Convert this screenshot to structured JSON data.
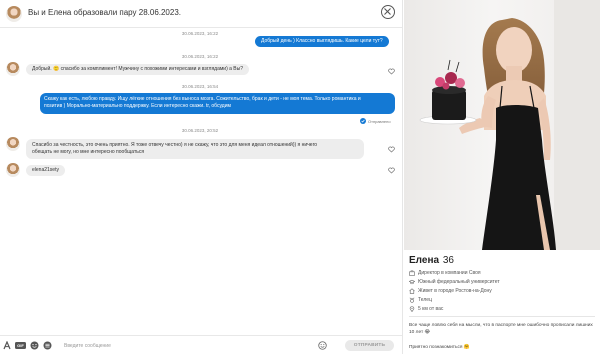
{
  "header": {
    "title": "Вы и Елена образовали пару 28.06.2023.",
    "close_icon": "close-circle-icon"
  },
  "chat": {
    "messages": [
      {
        "kind": "date",
        "text": "30.06.2023, 16:22"
      },
      {
        "kind": "outgoing",
        "text": "Добрый день ) Классно выглядишь. Какие цели тут?"
      },
      {
        "kind": "date",
        "text": "30.06.2023, 16:22"
      },
      {
        "kind": "incoming",
        "text": "Добрый. 🙂 спасибо за комплимент! Мужчину с похожими интересами и взглядами) а Вы?"
      },
      {
        "kind": "date",
        "text": "30.06.2023, 16:54"
      },
      {
        "kind": "outgoing",
        "lines": [
          "Скажу как есть, любою правду. Ищу лёгкие отношения без выноса мозга. Сожительство, брак и дети - не моя тема. Только романтика и",
          "позитив ) Морально-материально поддержку. Если интересно скажи. tг, обсудим"
        ]
      },
      {
        "kind": "status",
        "text": "Отправлено"
      },
      {
        "kind": "date",
        "text": "30.06.2023, 20:52"
      },
      {
        "kind": "incoming",
        "lines": [
          "Спасибо за честность, это очень приятно. Я тоже отвечу честно) я не скажу, что это для меня идеал отношений)) я ничего",
          "обещать не могу, но мне интересно пообщаться"
        ]
      },
      {
        "kind": "incoming",
        "text": "elena21sety"
      }
    ]
  },
  "input_bar": {
    "gif_label": "GIF",
    "placeholder": "Введите сообщение",
    "send_label": "ОТПРАВИТЬ"
  },
  "profile": {
    "name": "Елена",
    "age": "36",
    "info": [
      {
        "icon": "briefcase-icon",
        "text": "Директор в компании Своя"
      },
      {
        "icon": "graduation-cap-icon",
        "text": "Южный федеральный университет"
      },
      {
        "icon": "home-icon",
        "text": "Живет в городе Ростов-на-Дону"
      },
      {
        "icon": "zodiac-icon",
        "text": "Телец"
      },
      {
        "icon": "location-pin-icon",
        "text": "5 км от вас"
      }
    ],
    "bio": "Все чаще ловлю себя на мысли, что в паспорте мне ошибочно прописали лишних 10 лет 😂",
    "greeting": "Приятно познакомиться 🤗"
  },
  "colors": {
    "accent": "#1479d4",
    "incoming_bubble": "#ededed",
    "send_button": "#e9e9e9"
  }
}
